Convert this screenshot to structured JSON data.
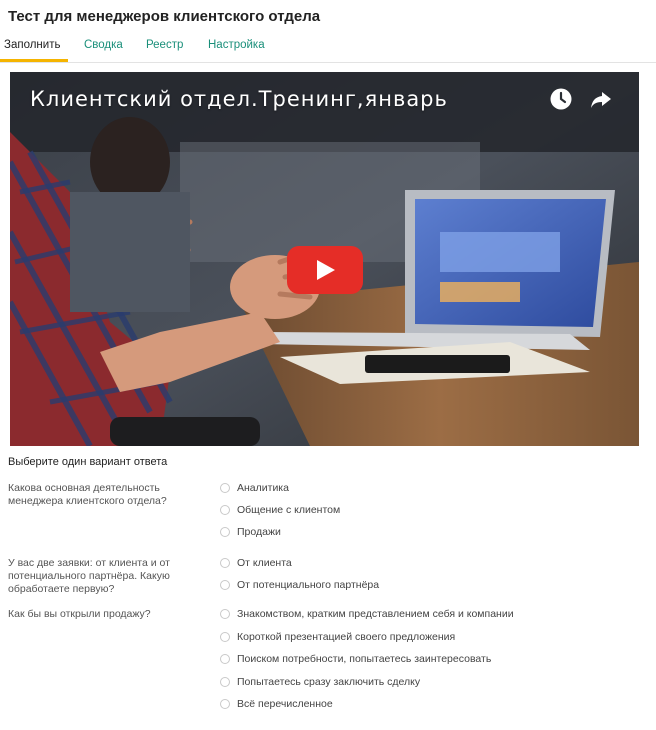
{
  "form_title": "Тест для менеджеров клиентского отдела",
  "tabs": [
    {
      "label": "Заполнить",
      "active": true
    },
    {
      "label": "Сводка",
      "active": false
    },
    {
      "label": "Реестр",
      "active": false
    },
    {
      "label": "Настройка",
      "active": false
    }
  ],
  "colors": {
    "accent_tab": "#f5b400",
    "link": "#1a8f7a",
    "play_button": "#e52d27"
  },
  "video": {
    "title": "Клиентский отдел.Тренинг,январь",
    "icons": [
      "watch-later-icon",
      "share-icon",
      "youtube-play-icon"
    ]
  },
  "instruction": "Выберите один вариант ответа",
  "questions": [
    {
      "text": "Какова основная деятельность менеджера клиентского отдела?",
      "options": [
        "Аналитика",
        "Общение с клиентом",
        "Продажи"
      ]
    },
    {
      "text": "У вас две заявки: от клиента и от потенциального партнёра. Какую обработаете первую?",
      "options": [
        "От клиента",
        "От потенциального партнёра"
      ]
    },
    {
      "text": "Как бы вы открыли продажу?",
      "options": [
        "Знакомством, кратким представлением себя и компании",
        "Короткой презентацией своего предложения",
        "Поиском потребности, попытаетесь заинтересовать",
        "Попытаетесь сразу заключить сделку",
        "Всё перечисленное"
      ]
    }
  ]
}
